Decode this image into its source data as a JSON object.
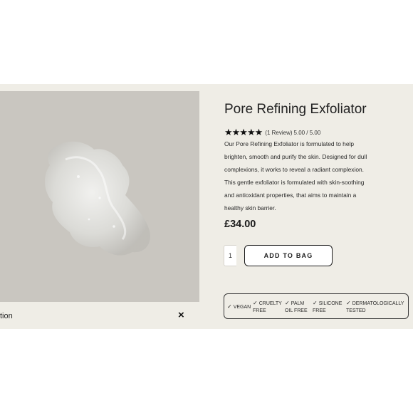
{
  "product": {
    "title": "Pore Refining Exfoliator",
    "stars": "★★★★★",
    "review_count": "(1 Review)",
    "rating_text": "5.00 / 5.00",
    "description": "Our Pore Refining Exfoliator is formulated to help brighten, smooth and purify the skin. Designed for dull complexions, it works to reveal a radiant complexion. This gentle exfoliator is formulated with skin-soothing and antioxidant properties, that aims to maintain a healthy skin barrier.",
    "price": "£34.00",
    "quantity": "1",
    "add_to_bag": "ADD TO BAG"
  },
  "badges": [
    {
      "line1": "VEGAN",
      "line2": ""
    },
    {
      "line1": "CRUELTY",
      "line2": "FREE"
    },
    {
      "line1": "PALM",
      "line2": "OIL FREE"
    },
    {
      "line1": "SILICONE",
      "line2": "FREE"
    },
    {
      "line1": "DERMATOLOGICALLY",
      "line2": "TESTED"
    }
  ],
  "description_bar": {
    "label": "tion",
    "close_icon": "×"
  },
  "colors": {
    "panel_background": "#efede6",
    "image_background": "#c9c6c0"
  }
}
